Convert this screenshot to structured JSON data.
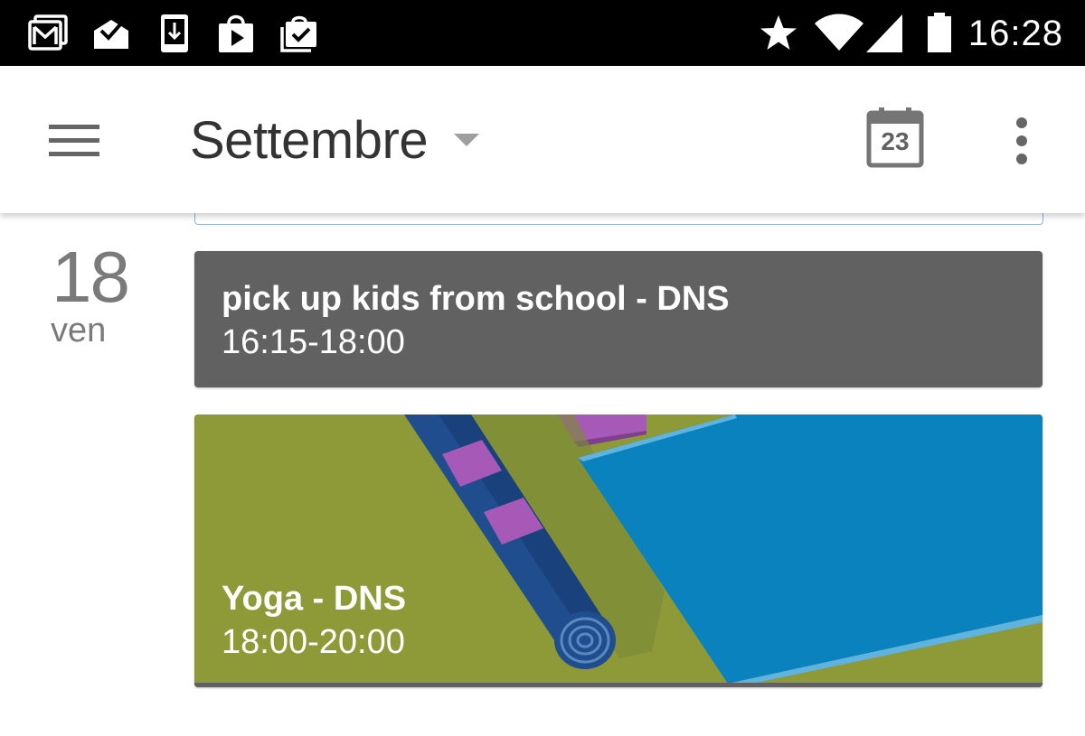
{
  "status_bar": {
    "icons_left": [
      "gmail-icon",
      "inbox-icon",
      "download-icon",
      "play-store-icon",
      "tasks-icon"
    ],
    "icons_right": [
      "star-icon",
      "wifi-icon",
      "signal-icon",
      "battery-icon"
    ],
    "time": "16:28"
  },
  "app_bar": {
    "menu_icon": "hamburger-menu-icon",
    "month": "Settembre",
    "dropdown_icon": "dropdown-arrow-icon",
    "today_button": {
      "icon": "calendar-today-icon",
      "day": "23"
    },
    "overflow_icon": "more-vert-icon"
  },
  "agenda": {
    "day": {
      "number": "18",
      "weekday": "ven"
    },
    "events": [
      {
        "title": "pick up kids from school - DNS",
        "time": "16:15-18:00",
        "color": "#616161"
      },
      {
        "title": "Yoga - DNS",
        "time": "18:00-20:00",
        "color": "#8e9938",
        "illustration": "yoga-mat-illustration"
      }
    ]
  },
  "colors": {
    "status_bar": "#000000",
    "app_bar": "#ffffff",
    "text_primary": "#333333",
    "text_secondary": "#7a7a7a",
    "yoga_mat_blue": "#0a82be",
    "accent_purple": "#a759b8"
  }
}
